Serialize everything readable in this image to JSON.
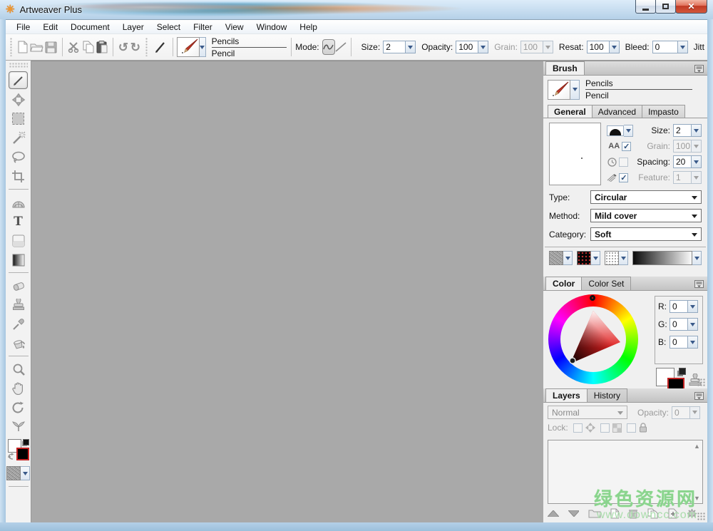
{
  "titlebar": {
    "title": "Artweaver Plus"
  },
  "menubar": {
    "items": [
      "File",
      "Edit",
      "Document",
      "Layer",
      "Select",
      "Filter",
      "View",
      "Window",
      "Help"
    ]
  },
  "toolbar": {
    "preset_category": "Pencils",
    "preset_name": "Pencil",
    "mode_label": "Mode:",
    "size_label": "Size:",
    "size_value": "2",
    "opacity_label": "Opacity:",
    "opacity_value": "100",
    "grain_label": "Grain:",
    "grain_value": "100",
    "resat_label": "Resat:",
    "resat_value": "100",
    "bleed_label": "Bleed:",
    "bleed_value": "0",
    "jitter_label": "Jitt"
  },
  "brush_panel": {
    "title": "Brush",
    "preset_category": "Pencils",
    "preset_name": "Pencil",
    "tabs": [
      "General",
      "Advanced",
      "Impasto"
    ],
    "active_tab": "General",
    "aa_label": "AA",
    "size_label": "Size:",
    "size_value": "2",
    "grain_label": "Grain:",
    "grain_value": "100",
    "spacing_label": "Spacing:",
    "spacing_value": "20",
    "feature_label": "Feature:",
    "feature_value": "1",
    "type_label": "Type:",
    "type_value": "Circular",
    "method_label": "Method:",
    "method_value": "Mild cover",
    "category_label": "Category:",
    "category_value": "Soft"
  },
  "color_panel": {
    "tabs": [
      "Color",
      "Color Set"
    ],
    "active_tab": "Color",
    "r_label": "R:",
    "r_value": "0",
    "g_label": "G:",
    "g_value": "0",
    "b_label": "B:",
    "b_value": "0"
  },
  "layers_panel": {
    "tabs": [
      "Layers",
      "History"
    ],
    "active_tab": "Layers",
    "blend_mode_value": "Normal",
    "opacity_label": "Opacity:",
    "opacity_value": "0",
    "lock_label": "Lock:"
  },
  "watermark": {
    "line1": "绿色资源网",
    "line2": "www.downcc.com"
  },
  "colors": {
    "canvas_gray": "#a9a9a9",
    "selected_swatch_border": "#c32222",
    "watermark_green": "#8ad48d",
    "close_button_red": "#c03a24",
    "panel_bg": "#f0f0f0"
  }
}
